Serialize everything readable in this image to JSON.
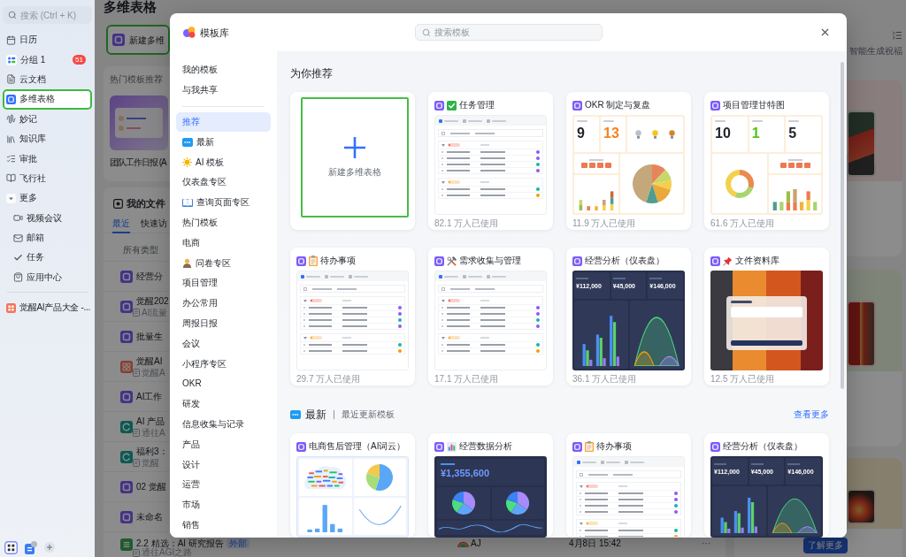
{
  "sidebar": {
    "search": {
      "placeholder": "搜索 (Ctrl + K)"
    },
    "items": [
      {
        "label": "日历",
        "selected": false,
        "highlighted": false
      },
      {
        "label": "分组 1",
        "badge": "51",
        "selected": false,
        "highlighted": false
      },
      {
        "label": "云文档",
        "selected": false,
        "highlighted": false
      },
      {
        "label": "多维表格",
        "selected": true,
        "highlighted": true
      },
      {
        "label": "妙记",
        "selected": false,
        "highlighted": false
      },
      {
        "label": "知识库",
        "selected": false,
        "highlighted": false
      },
      {
        "label": "审批",
        "selected": false,
        "highlighted": false
      },
      {
        "label": "飞行社",
        "selected": false,
        "highlighted": false
      },
      {
        "label": "更多",
        "selected": false,
        "highlighted": false,
        "expanded": true,
        "children": [
          {
            "label": "视频会议",
            "selected": false,
            "highlighted": false
          },
          {
            "label": "邮箱",
            "selected": false,
            "highlighted": false
          },
          {
            "label": "任务",
            "selected": false,
            "highlighted": false
          },
          {
            "label": "应用中心",
            "selected": false,
            "highlighted": false
          }
        ]
      }
    ],
    "pinned": [
      {
        "label": "觉醒AI产品大全 -...",
        "selected": false,
        "highlighted": false
      }
    ]
  },
  "page": {
    "title": "多维表格",
    "create_card": {
      "label": "新建多维",
      "highlighted": true
    },
    "templates": {
      "heading": "热门模板推荐",
      "items": [
        {
          "name": "团队工作日报 (A"
        }
      ]
    },
    "files": {
      "heading": "我的文件",
      "tabs": [
        {
          "label": "最近",
          "selected": true
        },
        {
          "label": "快速访",
          "selected": false
        }
      ],
      "filter": "所有类型",
      "rows": [
        {
          "name": "经营分"
        },
        {
          "name": "觉醒202",
          "subtitle": "AI流量"
        },
        {
          "name": "批量生"
        },
        {
          "name": "觉醒AI",
          "subtitle": "觉醒A"
        },
        {
          "name": "AI工作"
        },
        {
          "name": "AI 产品",
          "subtitle": "通往A"
        },
        {
          "name": "福利3：",
          "subtitle": "觉醒"
        },
        {
          "name": "02 觉醒"
        },
        {
          "name": "未命名"
        },
        {
          "name": "2.2 精选：AI 研究报告",
          "tag": "外部",
          "subtitle": "通往AGI之路",
          "owner": "AJ",
          "time": "4月8日 15:42",
          "more": "···"
        }
      ]
    },
    "side_panel": {
      "title": "智能生成祝福",
      "button": "了解更多"
    }
  },
  "dialog": {
    "title": "模板库",
    "search": {
      "placeholder": "搜索模板"
    },
    "nav": {
      "personal": [
        {
          "label": "我的模板",
          "selected": false
        },
        {
          "label": "与我共享",
          "selected": false
        }
      ],
      "categories": [
        {
          "label": "推荐",
          "selected": true
        },
        {
          "label": "最新",
          "selected": false
        },
        {
          "label": "AI 模板",
          "selected": false
        },
        {
          "label": "仪表盘专区",
          "selected": false
        },
        {
          "label": "查询页面专区",
          "selected": false
        },
        {
          "label": "热门模板",
          "selected": false
        },
        {
          "label": "电商",
          "selected": false
        },
        {
          "label": "问卷专区",
          "selected": false
        },
        {
          "label": "项目管理",
          "selected": false
        },
        {
          "label": "办公常用",
          "selected": false
        },
        {
          "label": "周报日报",
          "selected": false
        },
        {
          "label": "会议",
          "selected": false
        },
        {
          "label": "小程序专区",
          "selected": false
        },
        {
          "label": "OKR",
          "selected": false
        },
        {
          "label": "研发",
          "selected": false
        },
        {
          "label": "信息收集与记录",
          "selected": false
        },
        {
          "label": "产品",
          "selected": false
        },
        {
          "label": "设计",
          "selected": false
        },
        {
          "label": "运营",
          "selected": false
        },
        {
          "label": "市场",
          "selected": false
        },
        {
          "label": "销售",
          "selected": false
        }
      ]
    },
    "sections": [
      {
        "heading": "为你推荐",
        "create_card": {
          "label": "新建多维表格",
          "highlighted": true
        },
        "cards": [
          {
            "title": "任务管理",
            "usage": "82.1 万人已使用",
            "preview": {
              "kind": "table"
            }
          },
          {
            "title": "OKR 制定与复盘",
            "usage": "11.9 万人已使用",
            "preview": {
              "kind": "okr",
              "figures": [
                {
                  "value": "9",
                  "color": "#1f2329"
                },
                {
                  "value": "13",
                  "color": "#f5821f"
                }
              ]
            }
          },
          {
            "title": "项目管理甘特图",
            "usage": "61.6 万人已使用",
            "preview": {
              "kind": "gantt",
              "figures": [
                {
                  "value": "10",
                  "color": "#1f2329"
                },
                {
                  "value": "1",
                  "color": "#52c41a"
                },
                {
                  "value": "5",
                  "color": "#1f2329"
                }
              ]
            }
          },
          {
            "title": "待办事项",
            "usage": "29.7 万人已使用",
            "preview": {
              "kind": "table"
            }
          },
          {
            "title": "需求收集与管理",
            "usage": "17.1 万人已使用",
            "preview": {
              "kind": "table"
            }
          },
          {
            "title": "经营分析（仪表盘）",
            "usage": "36.1 万人已使用",
            "preview": {
              "kind": "dark_dashboard",
              "figures": [
                {
                  "value": "¥112,000"
                },
                {
                  "value": "¥45,000"
                },
                {
                  "value": "¥146,000"
                }
              ]
            }
          },
          {
            "title": "文件资料库",
            "usage": "12.5 万人已使用",
            "preview": {
              "kind": "photo_form"
            }
          }
        ]
      },
      {
        "heading": "最新",
        "subheading": "最近更新模板",
        "link": "查看更多",
        "cards": [
          {
            "title": "电商售后管理（AI词云）",
            "preview": {
              "kind": "word_cloud"
            }
          },
          {
            "title": "经营数据分析",
            "preview": {
              "kind": "dark_analysis",
              "figures": [
                {
                  "value": "¥1,355,600"
                }
              ]
            }
          },
          {
            "title": "待办事项",
            "preview": {
              "kind": "table"
            }
          },
          {
            "title": "经营分析（仪表盘）",
            "preview": {
              "kind": "dark_dashboard",
              "figures": [
                {
                  "value": "¥112,000"
                },
                {
                  "value": "¥45,000"
                },
                {
                  "value": "¥146,000"
                }
              ]
            }
          }
        ]
      }
    ]
  }
}
